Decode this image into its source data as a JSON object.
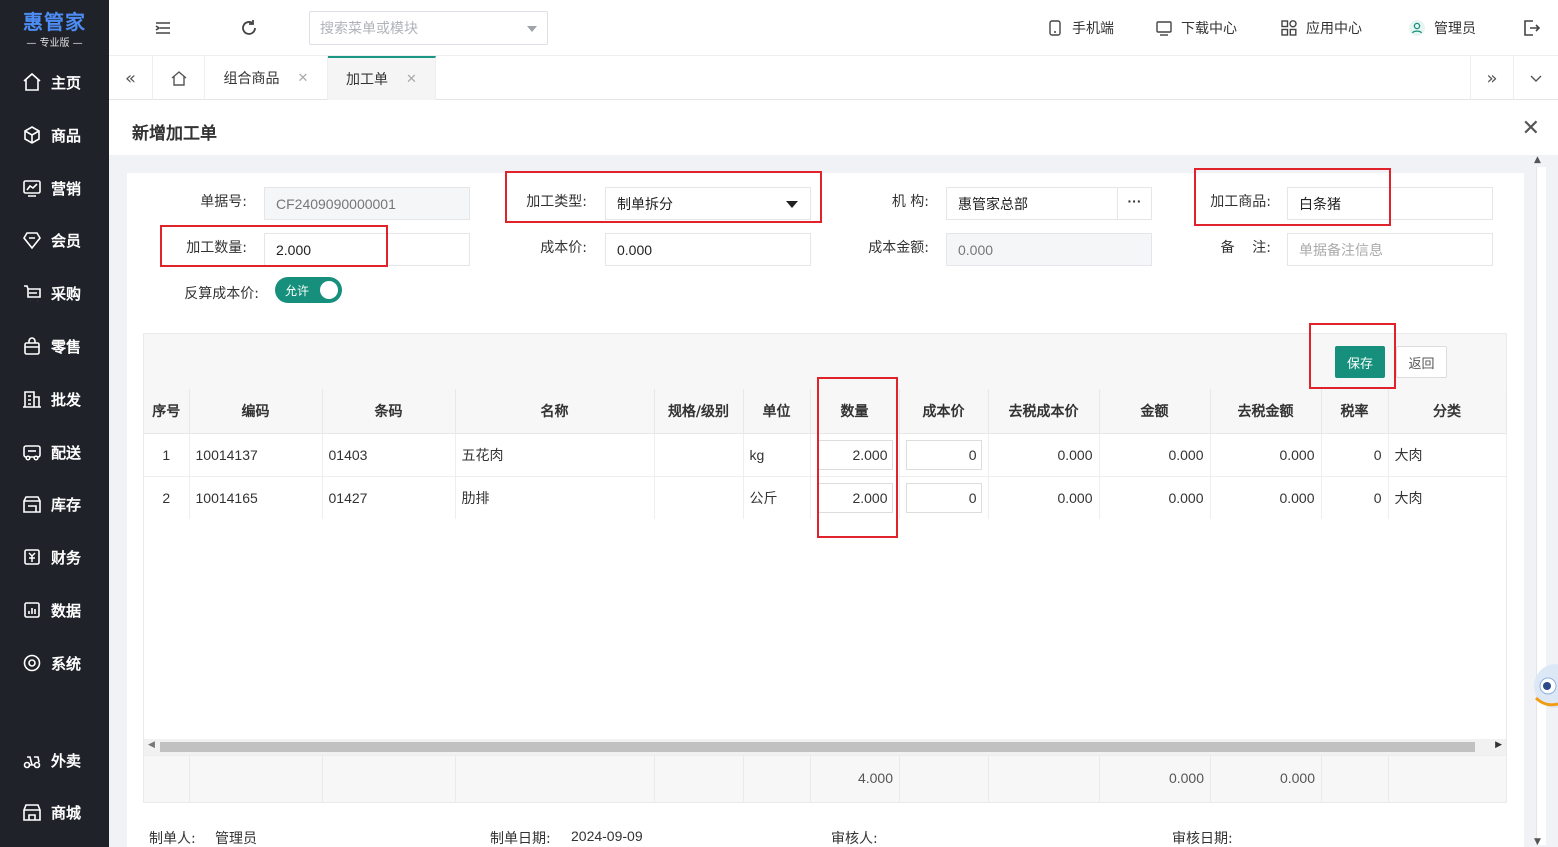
{
  "app": {
    "logo": "惠管家",
    "edition": "— 专业版 —"
  },
  "sidebar": {
    "items": [
      {
        "label": "主页",
        "icon": "home-icon"
      },
      {
        "label": "商品",
        "icon": "cube-icon"
      },
      {
        "label": "营销",
        "icon": "chart-icon"
      },
      {
        "label": "会员",
        "icon": "diamond-icon"
      },
      {
        "label": "采购",
        "icon": "cart-icon"
      },
      {
        "label": "零售",
        "icon": "bag-icon"
      },
      {
        "label": "批发",
        "icon": "building-icon"
      },
      {
        "label": "配送",
        "icon": "truck-icon"
      },
      {
        "label": "库存",
        "icon": "warehouse-icon"
      },
      {
        "label": "财务",
        "icon": "finance-icon"
      },
      {
        "label": "数据",
        "icon": "data-icon"
      },
      {
        "label": "系统",
        "icon": "settings-icon"
      },
      {
        "label": "外卖",
        "icon": "delivery-icon"
      },
      {
        "label": "商城",
        "icon": "store-icon"
      }
    ]
  },
  "header": {
    "search_placeholder": "搜索菜单或模块",
    "links": {
      "mobile": "手机端",
      "download": "下载中心",
      "apps": "应用中心",
      "user": "管理员"
    }
  },
  "tabs": [
    {
      "label": "组合商品"
    },
    {
      "label": "加工单"
    }
  ],
  "page": {
    "title": "新增加工单"
  },
  "form": {
    "doc_no_label": "单据号:",
    "doc_no": "CF2409090000001",
    "type_label": "加工类型:",
    "type": "制单拆分",
    "org_label": "机    构:",
    "org": "惠管家总部",
    "product_label": "加工商品:",
    "product": "白条猪",
    "qty_label": "加工数量:",
    "qty": "2.000",
    "cost_label": "成本价:",
    "cost": "0.000",
    "amount_label": "成本金额:",
    "amount": "0.000",
    "remark_label": "备    注:",
    "remark_placeholder": "单据备注信息",
    "reverse_label": "反算成本价:",
    "reverse_toggle": "允许"
  },
  "actions": {
    "save": "保存",
    "back": "返回"
  },
  "table": {
    "headers": [
      "序号",
      "编码",
      "条码",
      "名称",
      "规格/级别",
      "单位",
      "数量",
      "成本价",
      "去税成本价",
      "金额",
      "去税金额",
      "税率",
      "分类"
    ],
    "rows": [
      [
        "1",
        "10014137",
        "01403",
        "五花肉",
        "",
        "kg",
        "2.000",
        "0",
        "0.000",
        "0.000",
        "0.000",
        "0",
        "大肉"
      ],
      [
        "2",
        "10014165",
        "01427",
        "肋排",
        "",
        "公斤",
        "2.000",
        "0",
        "0.000",
        "0.000",
        "0.000",
        "0",
        "大肉"
      ]
    ],
    "totals": {
      "qty": "4.000",
      "amount": "0.000",
      "amount_notax": "0.000"
    }
  },
  "footer": {
    "maker_label": "制单人:",
    "maker": "管理员",
    "date_label": "制单日期:",
    "date": "2024-09-09",
    "auditor_label": "审核人:",
    "audit_date_label": "审核日期:"
  }
}
